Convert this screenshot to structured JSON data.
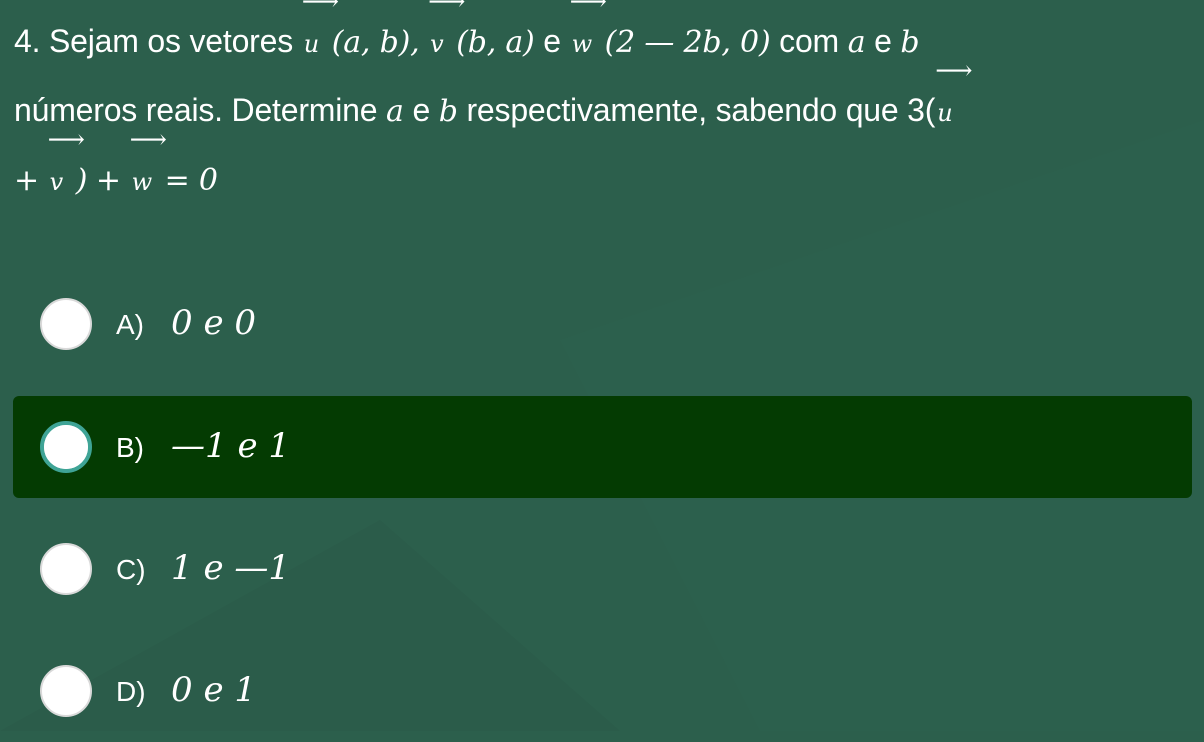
{
  "question": {
    "number": "4.",
    "intro": "Sejam os vetores",
    "vec_u": "u",
    "vec_v": "v",
    "vec_w": "w",
    "u_comps": "(a, b),",
    "v_comps": "(b, a)",
    "conj_e1": "e",
    "w_comps": "(2 — 2b, 0)",
    "com": "com",
    "var_a": "a",
    "conj_e2": "e",
    "var_b": "b",
    "line2_text": "números reais. Determine",
    "conj_e3": "e",
    "line2_rest": "respectivamente, sabendo que 3(",
    "plus1": "+",
    "close_paren": ")",
    "plus2": "+",
    "equals_zero": "= 0",
    "arrow": "⟶"
  },
  "options": [
    {
      "letter": "A)",
      "value": "0 e 0",
      "selected": false
    },
    {
      "letter": "B)",
      "value": "—1 e 1",
      "selected": true
    },
    {
      "letter": "C)",
      "value": "1 e —1",
      "selected": false
    },
    {
      "letter": "D)",
      "value": "0 e 1",
      "selected": false
    }
  ],
  "colors": {
    "background": "#2c5f4c",
    "selected_background": "#043b02",
    "radio_accent": "#3fa496",
    "text": "#ffffff"
  }
}
